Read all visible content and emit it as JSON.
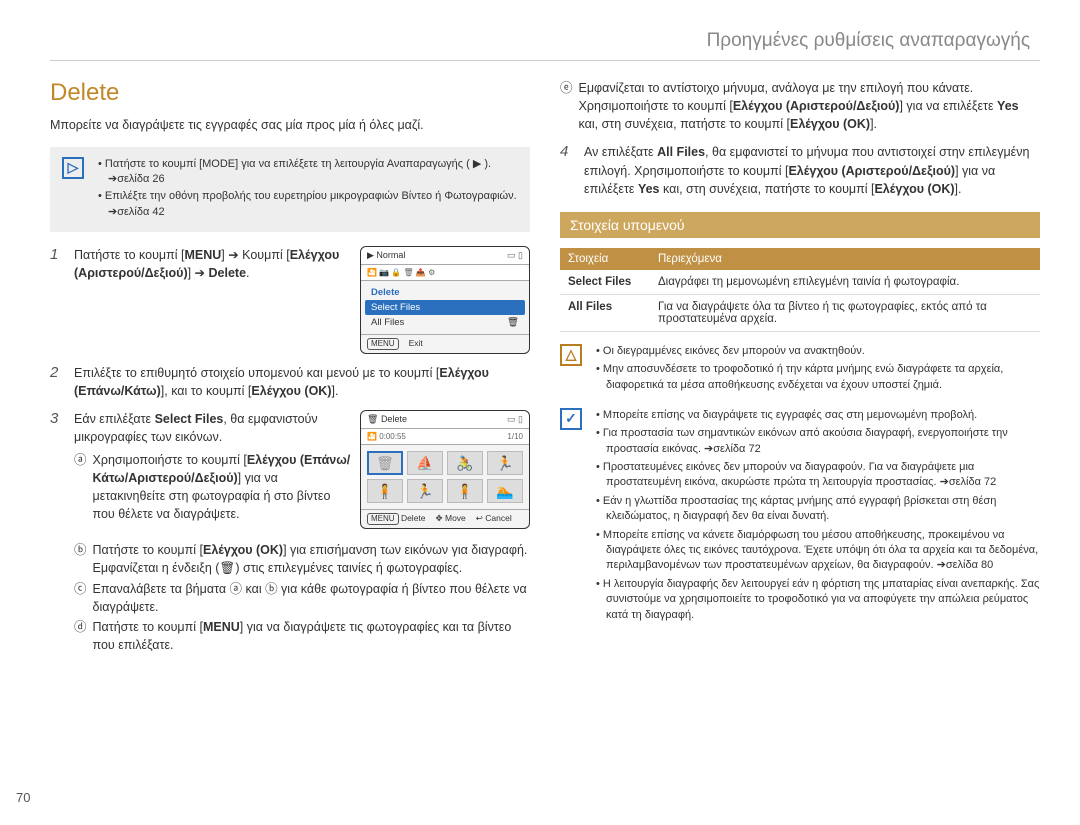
{
  "header": "Προηγμένες ρυθμίσεις αναπαραγωγής",
  "page_number": "70",
  "section": {
    "title": "Delete",
    "intro": "Μπορείτε να διαγράψετε τις εγγραφές σας μία προς μία ή όλες μαζί."
  },
  "note1": {
    "items": [
      "Πατήστε το κουμπί [MODE] για να επιλέξετε τη λειτουργία Αναπαραγωγής ( ▶ ). ➔σελίδα 26",
      "Επιλέξτε την οθόνη προβολής του ευρετηρίου μικρογραφιών Βίντεο ή Φωτογραφιών. ➔σελίδα 42"
    ]
  },
  "steps": {
    "s1": {
      "num": "1",
      "text_a": "Πατήστε το κουμπί [",
      "text_b": "MENU",
      "text_c": "] ➔ Κουμπί [",
      "text_d": "Ελέγχου (Αριστερού/Δεξιού)",
      "text_e": "] ➔ ",
      "text_f": "Delete",
      "text_g": "."
    },
    "s2": {
      "num": "2",
      "text_a": "Επιλέξτε το επιθυμητό στοιχείο υπομενού και μενού με το κουμπί [",
      "text_b": "Ελέγχου (Επάνω/Κάτω)",
      "text_c": "], και το κουμπί [",
      "text_d": "Ελέγχου (OK)",
      "text_e": "]."
    },
    "s3": {
      "num": "3",
      "text_a": "Εάν επιλέξατε ",
      "text_b": "Select Files",
      "text_c": ", θα εμφανιστούν μικρογραφίες των εικόνων.",
      "a": {
        "l": "ⓐ",
        "t1": "Χρησιμοποιήστε το κουμπί [",
        "t2": "Ελέγχου (Επάνω/Κάτω/Αριστερού/Δεξιού)",
        "t3": "] για να μετακινηθείτε στη φωτογραφία ή στο βίντεο που θέλετε να διαγράψετε."
      },
      "b": {
        "l": "ⓑ",
        "t1": "Πατήστε το κουμπί [",
        "t2": "Ελέγχου (OK)",
        "t3": "] για επισήμανση των εικόνων για διαγραφή. Εμφανίζεται η ένδειξη (🗑) στις επιλεγμένες ταινίες ή φωτογραφίες."
      },
      "c": {
        "l": "ⓒ",
        "t": "Επαναλάβετε τα βήματα ⓐ και ⓑ για κάθε φωτογραφία ή βίντεο που θέλετε να διαγράψετε."
      },
      "d": {
        "l": "ⓓ",
        "t1": "Πατήστε το κουμπί [",
        "t2": "MENU",
        "t3": "] για να διαγράψετε τις φωτογραφίες και τα βίντεο που επιλέξατε."
      },
      "e": {
        "l": "ⓔ",
        "t1": "Εμφανίζεται το αντίστοιχο μήνυμα, ανάλογα με την επιλογή που κάνατε. Χρησιμοποιήστε το κουμπί [",
        "t2": "Ελέγχου (Αριστερού/Δεξιού)",
        "t3": "] για να επιλέξετε ",
        "t4": "Yes",
        "t5": " και, στη συνέχεια, πατήστε το κουμπί [",
        "t6": "Ελέγχου (OK)",
        "t7": "]."
      }
    },
    "s4": {
      "num": "4",
      "t1": "Αν επιλέξατε ",
      "t2": "All Files",
      "t3": ", θα εμφανιστεί το μήνυμα που αντιστοιχεί στην επιλεγμένη επιλογή. Χρησιμοποιήστε το κουμπί [",
      "t4": "Ελέγχου (Αριστερού/Δεξιού)",
      "t5": "] για να επιλέξετε ",
      "t6": "Yes",
      "t7": " και, στη συνέχεια, πατήστε το κουμπί [",
      "t8": "Ελέγχου (OK)",
      "t9": "]."
    }
  },
  "submenu": {
    "heading": "Στοιχεία υπομενού",
    "col1": "Στοιχεία",
    "col2": "Περιεχόμενα",
    "rows": [
      {
        "k": "Select Files",
        "v": "Διαγράφει τη μεμονωμένη επιλεγμένη ταινία ή φωτογραφία."
      },
      {
        "k": "All Files",
        "v": "Για να διαγράψετε όλα τα βίντεο ή τις φωτογραφίες, εκτός από τα προστατευμένα αρχεία."
      }
    ]
  },
  "warn": {
    "items": [
      "Οι διεγραμμένες εικόνες δεν μπορούν να ανακτηθούν.",
      "Μην αποσυνδέσετε το τροφοδοτικό ή την κάρτα μνήμης ενώ διαγράφετε τα αρχεία, διαφορετικά τα μέσα αποθήκευσης ενδέχεται να έχουν υποστεί ζημιά."
    ]
  },
  "tip": {
    "items": [
      "Μπορείτε επίσης να διαγράψετε τις εγγραφές σας στη μεμονωμένη προβολή.",
      "Για προστασία των σημαντικών εικόνων από ακούσια διαγραφή, ενεργοποιήστε την προστασία εικόνας. ➔σελίδα 72",
      "Προστατευμένες εικόνες δεν μπορούν να διαγραφούν. Για να διαγράψετε μια προστατευμένη εικόνα, ακυρώστε πρώτα τη λειτουργία προστασίας. ➔σελίδα 72",
      "Εάν η γλωττίδα προστασίας της κάρτας μνήμης από εγγραφή βρίσκεται στη θέση κλειδώματος, η διαγραφή δεν θα είναι δυνατή.",
      "Μπορείτε επίσης να κάνετε διαμόρφωση του μέσου αποθήκευσης, προκειμένου να διαγράψετε όλες τις εικόνες ταυτόχρονα. Έχετε υπόψη ότι όλα τα αρχεία και τα δεδομένα, περιλαμβανομένων των προστατευμένων αρχείων, θα διαγραφούν. ➔σελίδα 80",
      "Η λειτουργία διαγραφής δεν λειτουργεί εάν η φόρτιση της μπαταρίας είναι ανεπαρκής. Σας συνιστούμε να χρησιμοποιείτε το τροφοδοτικό για να αποφύγετε την απώλεια ρεύματος κατά τη διαγραφή."
    ]
  },
  "screen1": {
    "top": "Normal",
    "delete": "Delete",
    "select": "Select Files",
    "all": "All Files",
    "exit_label": "Exit",
    "menu_label": "MENU"
  },
  "screen2": {
    "top": "Delete",
    "timer": "0:00:55",
    "counter": "1/10",
    "menu": "MENU",
    "del": "Delete",
    "move": "Move",
    "cancel": "Cancel"
  }
}
